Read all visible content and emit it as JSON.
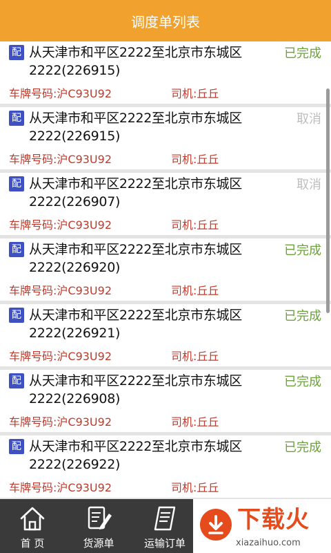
{
  "header": {
    "title": "调度单列表"
  },
  "orders": [
    {
      "badge": "配",
      "route": "从天津市和平区2222至北京市东城区2222(226915)",
      "status": "已完成",
      "status_type": "done",
      "plate": "车牌号码:沪C93U92",
      "driver": "司机:丘丘"
    },
    {
      "badge": "配",
      "route": "从天津市和平区2222至北京市东城区2222(226915)",
      "status": "取消",
      "status_type": "cancel",
      "plate": "车牌号码:沪C93U92",
      "driver": "司机:丘丘"
    },
    {
      "badge": "配",
      "route": "从天津市和平区2222至北京市东城区2222(226907)",
      "status": "取消",
      "status_type": "cancel",
      "plate": "车牌号码:沪C93U92",
      "driver": "司机:丘丘"
    },
    {
      "badge": "配",
      "route": "从天津市和平区2222至北京市东城区2222(226920)",
      "status": "已完成",
      "status_type": "done",
      "plate": "车牌号码:沪C93U92",
      "driver": "司机:丘丘"
    },
    {
      "badge": "配",
      "route": "从天津市和平区2222至北京市东城区2222(226921)",
      "status": "已完成",
      "status_type": "done",
      "plate": "车牌号码:沪C93U92",
      "driver": "司机:丘丘"
    },
    {
      "badge": "配",
      "route": "从天津市和平区2222至北京市东城区2222(226908)",
      "status": "已完成",
      "status_type": "done",
      "plate": "车牌号码:沪C93U92",
      "driver": "司机:丘丘"
    },
    {
      "badge": "配",
      "route": "从天津市和平区2222至北京市东城区2222(226922)",
      "status": "已完成",
      "status_type": "done",
      "plate": "车牌号码:沪C93U92",
      "driver": "司机:丘丘"
    }
  ],
  "tabbar": {
    "items": [
      {
        "label": "首 页",
        "icon": "home-icon"
      },
      {
        "label": "货源单",
        "icon": "edit-document-icon"
      },
      {
        "label": "运输订单",
        "icon": "order-list-icon"
      }
    ]
  },
  "watermark": {
    "logo": "下载火",
    "site": "xiazaihuo.com"
  },
  "colors": {
    "header_bg": "#f0a12e",
    "badge_bg": "#3f51c0",
    "status_done": "#6ba33a",
    "status_cancel": "#bdbdbd",
    "detail_red": "#c0392b",
    "tabbar_bg": "#3a3a3a",
    "watermark_red": "#e54b1c"
  }
}
